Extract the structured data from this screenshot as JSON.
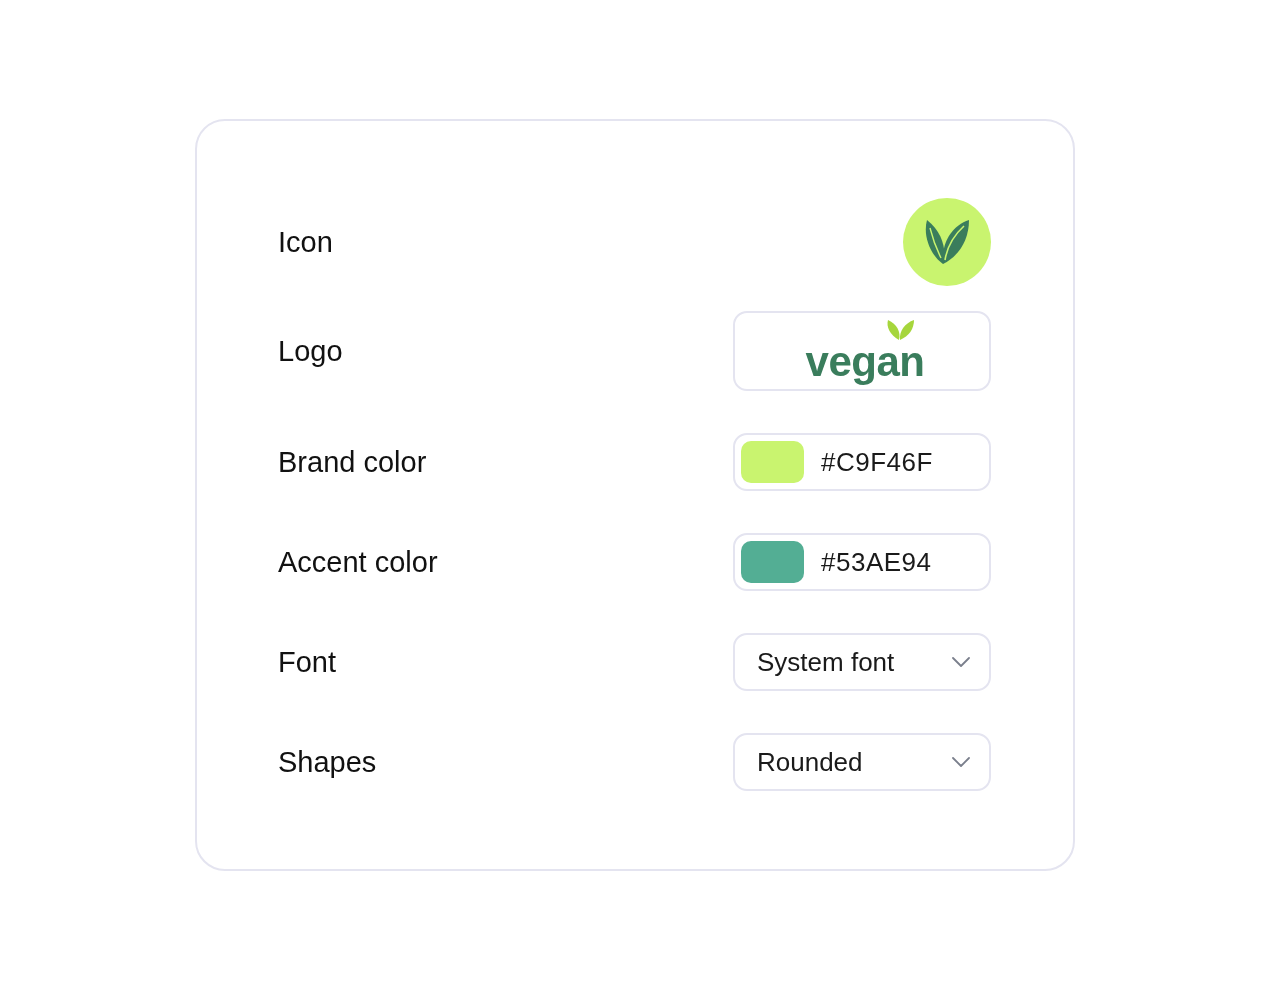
{
  "settings": {
    "rows": [
      {
        "kind": "icon",
        "label": "Icon"
      },
      {
        "kind": "logo",
        "label": "Logo",
        "logo_text": "vegan"
      },
      {
        "kind": "color",
        "label": "Brand color",
        "value": "#C9F46F",
        "color": "#c9f46f"
      },
      {
        "kind": "color",
        "label": "Accent color",
        "value": "#53AE94",
        "color": "#53ae94"
      },
      {
        "kind": "select",
        "label": "Font",
        "value": "System font"
      },
      {
        "kind": "select",
        "label": "Shapes",
        "value": "Rounded"
      }
    ]
  }
}
